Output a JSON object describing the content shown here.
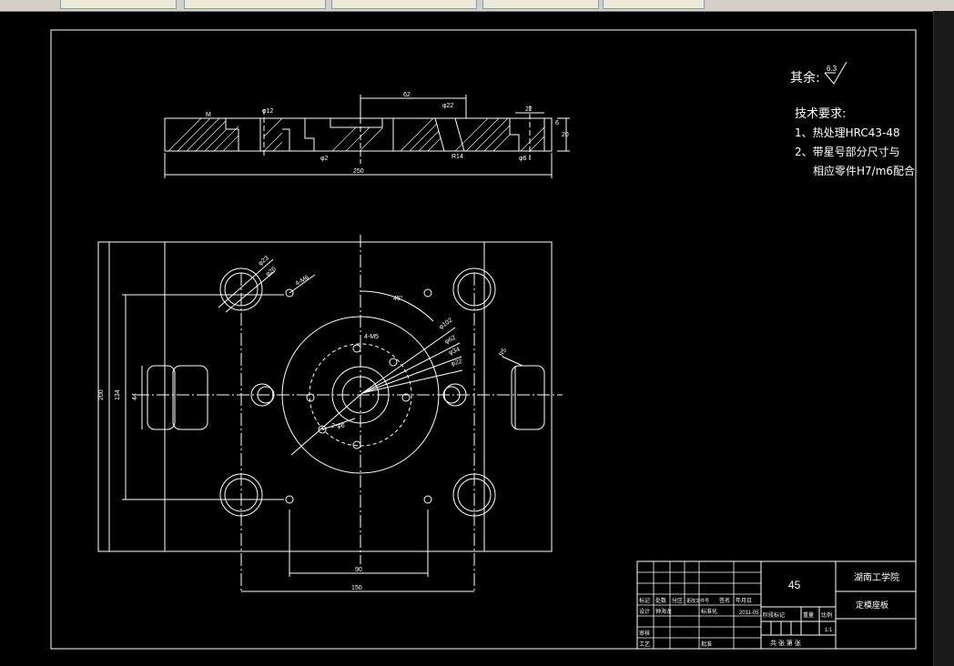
{
  "window": {
    "tabs": [
      "",
      "",
      "",
      "",
      ""
    ],
    "colors": {
      "background": "#000000",
      "lines": "#ffffff",
      "chrome": "#d4d0c8"
    }
  },
  "surface_finish": {
    "label": "其余:",
    "value": "6.3"
  },
  "tech_requirements": {
    "title": "技术要求:",
    "items": [
      "1、热处理HRC43-48",
      "2、带星号部分尺寸与",
      "相应零件H7/m6配合"
    ]
  },
  "section_view": {
    "dim_overall": "250",
    "dim_top": "62",
    "dim_right": "22",
    "dim_height": "20",
    "dim_small_right": "6",
    "ref_labels": [
      "M",
      "φ12",
      "φ22",
      "φ6",
      "φ2",
      "R14"
    ]
  },
  "plan_view": {
    "dim_height_outer": "200",
    "dim_height_inner": "134",
    "dim_height_core": "44",
    "dim_bottom_inner": "90",
    "dim_bottom_outer": "150",
    "hole_labels": [
      "φ23",
      "φ26",
      "4-M6",
      "4-M5",
      "2-φ6"
    ],
    "angle": "45°",
    "radial_labels": [
      "φ102",
      "φ62",
      "φ34",
      "φ22"
    ],
    "right_label": "R5"
  },
  "title_block": {
    "material": "45",
    "school": "湖南工学院",
    "part_name": "定模座板",
    "date": "2011-05",
    "scale": "1:1",
    "row_labels": [
      "标记",
      "处数",
      "分区",
      "更改文件号",
      "签名",
      "年月日"
    ],
    "design_label": "设计",
    "designer": "钟海龙",
    "standard_label": "标准化",
    "stage_label": "阶段标记",
    "weight_label": "重量",
    "scale_label": "比例",
    "check_label": "审核",
    "process_label": "工艺",
    "approve_label": "批准",
    "sheets_label": "共 张 第 张"
  }
}
